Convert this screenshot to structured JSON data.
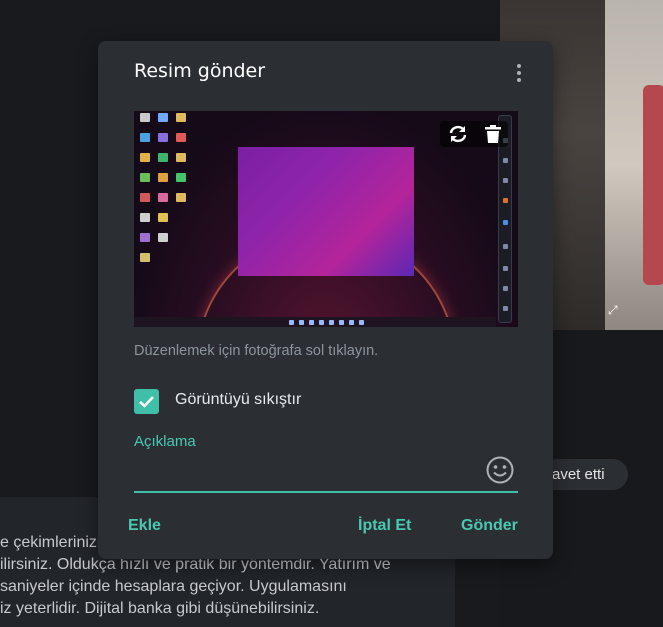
{
  "background": {
    "invite_pill": "avet etti",
    "message_lines": [
      "e çekimlerinizi",
      "ilirsiniz. Oldukça hızlı ve pratik bir yöntemdir. Yatırım ve",
      "saniyeler içinde hesaplara geçiyor. Uygulamasını",
      "iz yeterlidir. Dijital banka gibi düşünebilirsiniz."
    ]
  },
  "dialog": {
    "title": "Resim gönder",
    "hint": "Düzenlemek için fotoğrafa sol tıklayın.",
    "compress_label": "Görüntüyü sıkıştır",
    "compress_checked": true,
    "caption_label": "Açıklama",
    "caption_value": "",
    "buttons": {
      "add": "Ekle",
      "cancel": "İptal Et",
      "send": "Gönder"
    }
  },
  "colors": {
    "accent": "#48c9b0",
    "dialog_bg": "#2b2f34",
    "page_bg": "#17191c"
  },
  "icons": [
    "more-vertical-icon",
    "rotate-icon",
    "delete-icon",
    "checkmark-icon",
    "emoji-icon",
    "expand-icon"
  ]
}
